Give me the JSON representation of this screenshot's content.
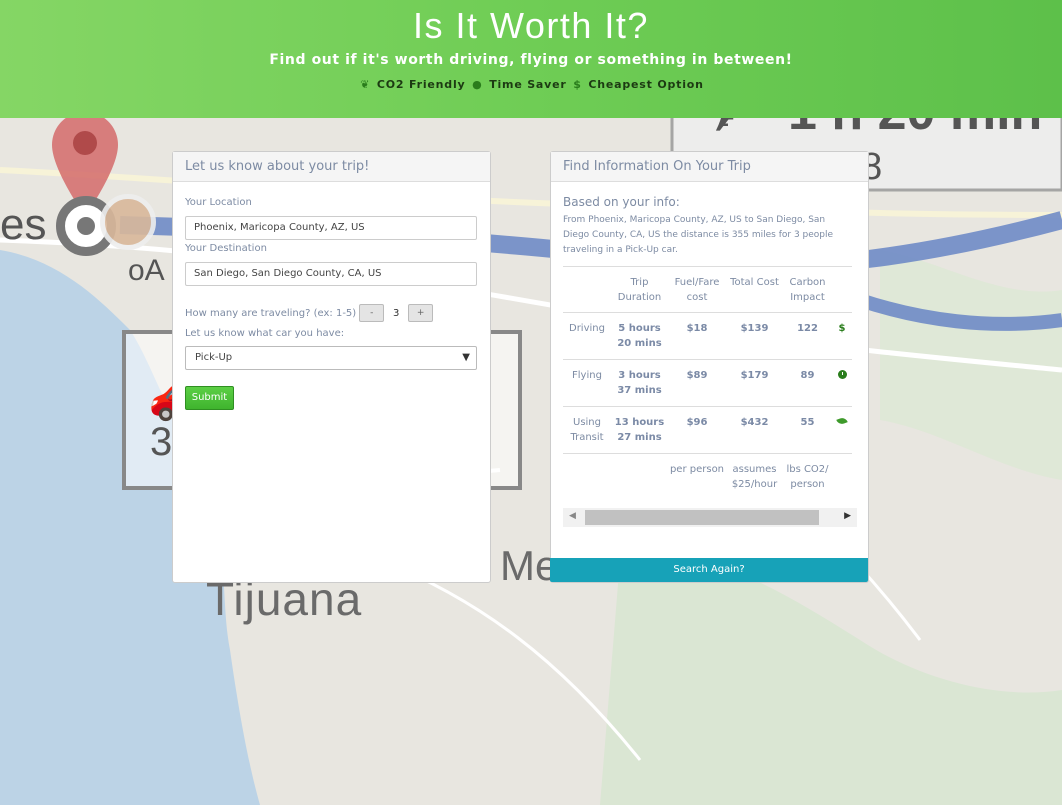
{
  "header": {
    "title": "Is It Worth It?",
    "subtitle": "Find out if it's worth driving, flying or something in between!",
    "legend": {
      "co2": "CO2 Friendly",
      "time": "Time Saver",
      "cheap": "Cheapest Option"
    }
  },
  "map": {
    "labels": {
      "es": "es",
      "oa": "oA",
      "tijuana": "Tijuana",
      "me": "Me",
      "flight_time": "1 h 20 min",
      "flight_sub": "88",
      "box_num": "3"
    }
  },
  "trip_form": {
    "heading": "Let us know about your trip!",
    "location_label": "Your Location",
    "location_value": "Phoenix, Maricopa County, AZ, US",
    "destination_label": "Your Destination",
    "destination_value": "San Diego, San Diego County, CA, US",
    "travelers_label": "How many are traveling? (ex: 1-5)",
    "minus_label": "-",
    "travelers_value": "3",
    "plus_label": "+",
    "car_label": "Let us know what car you have:",
    "car_value": "Pick-Up",
    "submit_label": "Submit"
  },
  "info": {
    "heading": "Find Information On Your Trip",
    "title": "Based on your info:",
    "summary": "From Phoenix, Maricopa County, AZ, US to San Diego, San Diego County, CA, US the distance is 355 miles for 3 people traveling in a Pick-Up car.",
    "columns": [
      "",
      "Trip Duration",
      "Fuel/Fare cost",
      "Total Cost",
      "Carbon Impact",
      ""
    ],
    "rows": [
      {
        "mode": "Driving",
        "duration": "5 hours 20 mins",
        "fuel": "$18",
        "total": "$139",
        "carbon": "122",
        "icon": "dollar-icon",
        "icon_text": "$"
      },
      {
        "mode": "Flying",
        "duration": "3 hours 37 mins",
        "fuel": "$89",
        "total": "$179",
        "carbon": "89",
        "icon": "clock-icon",
        "icon_text": ""
      },
      {
        "mode": "Using Transit",
        "duration": "13 hours 27 mins",
        "fuel": "$96",
        "total": "$432",
        "carbon": "55",
        "icon": "leaf-icon",
        "icon_text": ""
      }
    ],
    "footer": [
      "",
      "",
      "per person",
      "assumes $25/hour",
      "lbs CO2/ person",
      ""
    ],
    "search_again": "Search Again?"
  },
  "colors": {
    "header_green": "#6fcd55",
    "accent_teal": "#17a2b8",
    "submit_green": "#4cbf38",
    "icon_green": "#2a7d1c",
    "text_muted": "#7d8ba3"
  }
}
